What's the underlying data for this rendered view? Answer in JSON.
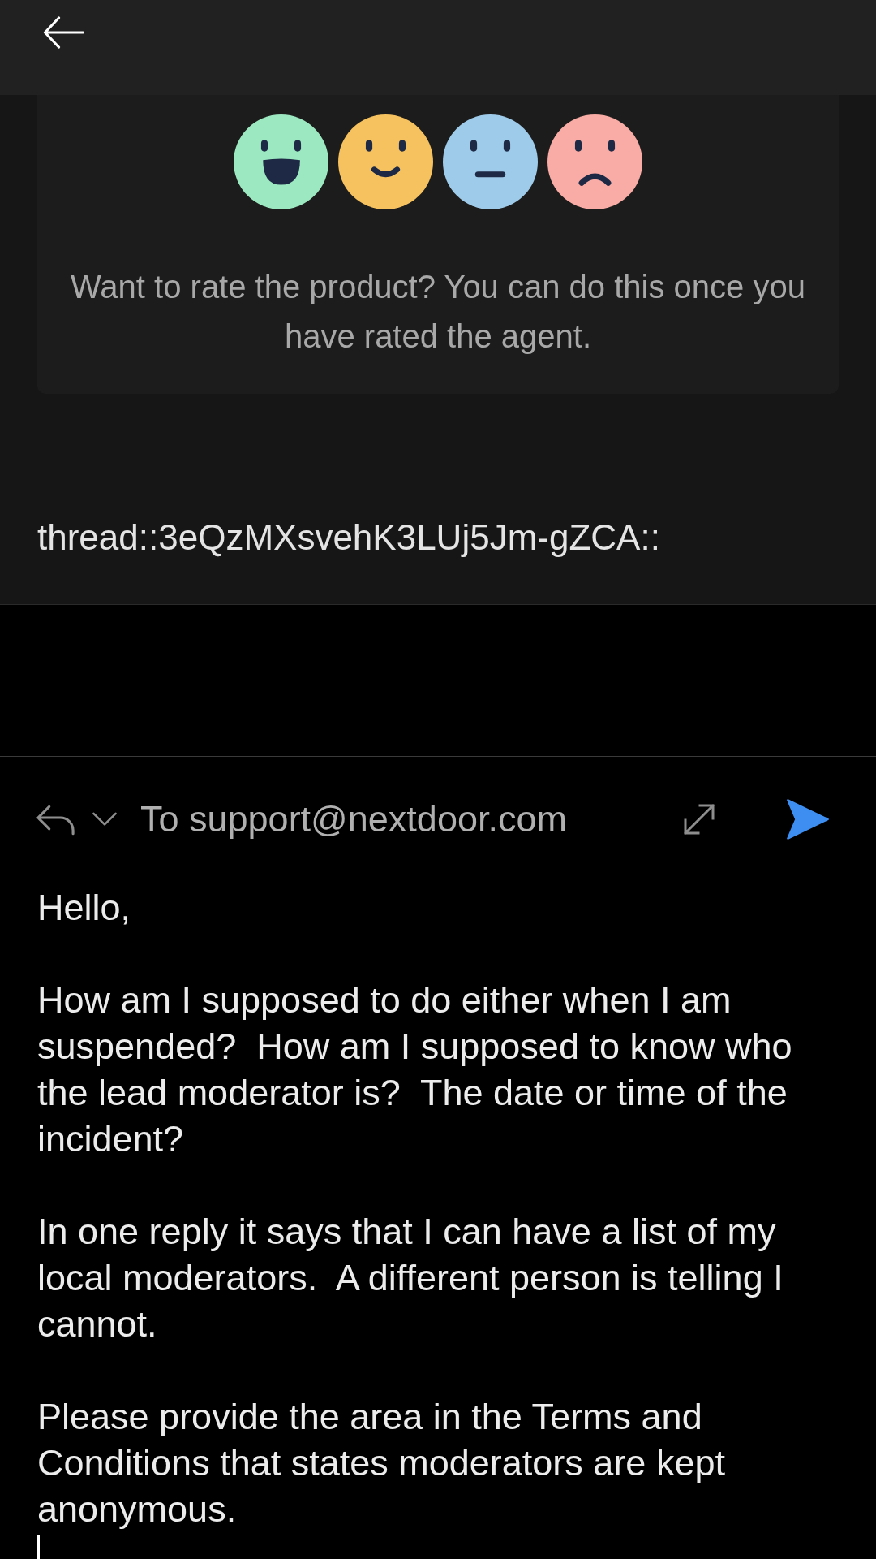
{
  "rating_card": {
    "faces": [
      {
        "kind": "laughing",
        "color": "#9ce9c1"
      },
      {
        "kind": "smiling",
        "color": "#f6c25f"
      },
      {
        "kind": "neutral",
        "color": "#9fcbea"
      },
      {
        "kind": "frowning",
        "color": "#f9aba5"
      }
    ],
    "prompt": "Want to rate the product? You can do this once you have rated the agent."
  },
  "thread_id": "thread::3eQzMXsvehK3LUj5Jm-gZCA::",
  "compose": {
    "recipient": "To support@nextdoor.com",
    "focused": true,
    "paragraphs": [
      "Hello,",
      "How am I supposed to do either when I am suspended?  How am I supposed to know who the lead moderator is?  The date or time of the incident?",
      "In one reply it says that I can have a list of my local moderators.  A different person is telling I cannot.",
      "Please provide the area in the Terms and Conditions that states moderators are kept anonymous."
    ]
  }
}
